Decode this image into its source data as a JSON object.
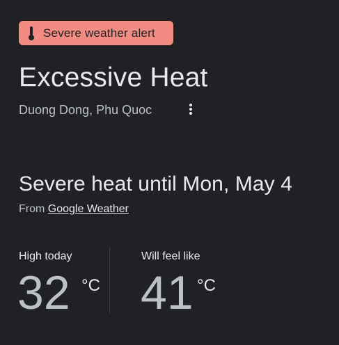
{
  "alert": {
    "label": "Severe weather alert",
    "icon": "thermometer-icon",
    "background_color": "#f28b82"
  },
  "title": "Excessive Heat",
  "location": "Duong Dong, Phu Quoc",
  "headline": "Severe heat until Mon, May 4",
  "source": {
    "prefix": "From",
    "link_label": "Google Weather"
  },
  "stats": [
    {
      "label": "High today",
      "value": "32",
      "unit": "°C"
    },
    {
      "label": "Will feel like",
      "value": "41",
      "unit": "°C"
    }
  ],
  "colors": {
    "background": "#202124",
    "text_primary": "#e8eaed",
    "text_secondary": "#bdc1c6"
  }
}
